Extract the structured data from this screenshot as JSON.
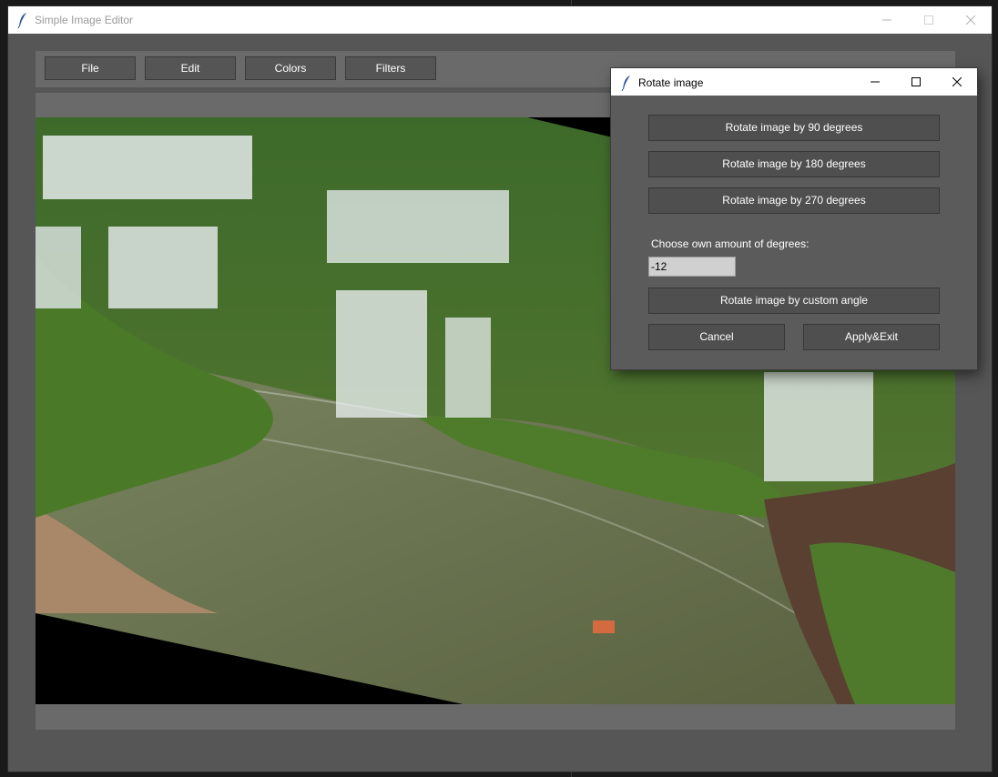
{
  "app": {
    "title": "Simple Image Editor"
  },
  "menu": {
    "file": "File",
    "edit": "Edit",
    "colors": "Colors",
    "filters": "Filters"
  },
  "dialog": {
    "title": "Rotate image",
    "rotate90": "Rotate image by 90 degrees",
    "rotate180": "Rotate image by 180 degrees",
    "rotate270": "Rotate image by 270 degrees",
    "custom_label": "Choose own amount of degrees:",
    "custom_value": "-12",
    "rotate_custom": "Rotate image by custom angle",
    "cancel": "Cancel",
    "apply": "Apply&Exit"
  },
  "colors": {
    "window_bg": "#565656",
    "panel_bg": "#6a6a6a",
    "button_bg": "#555555",
    "dialog_bg": "#5b5b5b"
  },
  "icons": {
    "app": "feather-icon",
    "minimize": "minimize-icon",
    "maximize": "maximize-icon",
    "close": "close-icon"
  }
}
